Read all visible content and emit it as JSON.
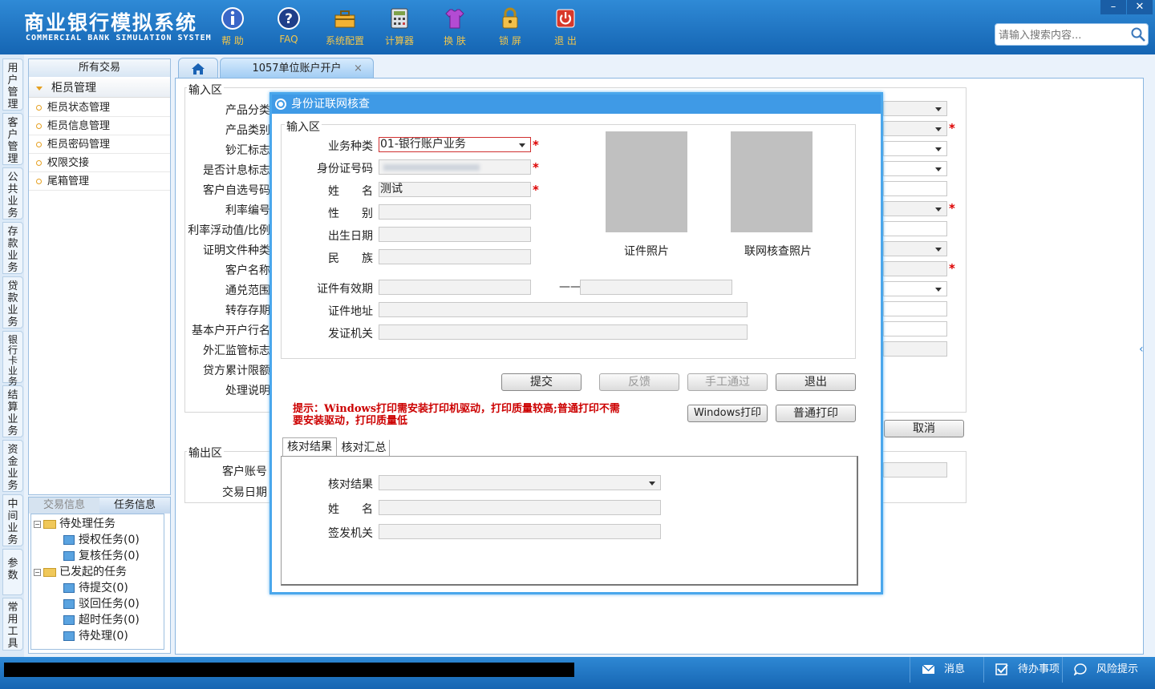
{
  "header": {
    "brand_cn": "商业银行模拟系统",
    "brand_en": "COMMERCIAL BANK SIMULATION SYSTEM",
    "tools": [
      {
        "label": "帮 助",
        "icon": "info-icon"
      },
      {
        "label": "FAQ",
        "icon": "help-icon"
      },
      {
        "label": "系统配置",
        "icon": "toolbox-icon"
      },
      {
        "label": "计算器",
        "icon": "calculator-icon"
      },
      {
        "label": "换 肤",
        "icon": "shirt-icon"
      },
      {
        "label": "锁 屏",
        "icon": "lock-icon"
      },
      {
        "label": "退 出",
        "icon": "power-icon"
      }
    ],
    "window_controls": [
      "–",
      "✕"
    ],
    "search_placeholder": "请输入搜索内容..."
  },
  "side_categories": [
    "用户管理",
    "客户管理",
    "公共业务",
    "存款业务",
    "贷款业务",
    "银行卡业务",
    "结算业务",
    "资金业务",
    "中间业务",
    "参数",
    "常用工具"
  ],
  "left_panel": {
    "header": "所有交易",
    "group": "柜员管理",
    "items": [
      "柜员状态管理",
      "柜员信息管理",
      "柜员密码管理",
      "权限交接",
      "尾箱管理"
    ]
  },
  "task_panel": {
    "tabs": [
      "交易信息",
      "任务信息"
    ],
    "pending_group": "待处理任务",
    "pending_items": [
      "授权任务(0)",
      "复核任务(0)"
    ],
    "initiated_group": "已发起的任务",
    "initiated_items": [
      "待提交(0)",
      "驳回任务(0)",
      "超时任务(0)",
      "待处理(0)"
    ]
  },
  "main_tabs": {
    "home_icon": "home-icon",
    "active_tab": "1057单位账户开户",
    "close": "×"
  },
  "form": {
    "input_legend": "输入区",
    "labels": [
      "产品分类",
      "产品类别",
      "钞汇标志",
      "是否计息标志",
      "客户自选号码",
      "利率编号",
      "利率浮动值/比例",
      "证明文件种类",
      "客户名称",
      "通兑范围",
      "转存存期",
      "基本户开户行名",
      "外汇监管标志",
      "贷方累计限额",
      "处理说明"
    ],
    "cancel_button": "取消",
    "output_legend": "输出区",
    "output_labels": [
      "客户账号",
      "交易日期"
    ]
  },
  "dialog": {
    "title": "身份证联网核查",
    "input_legend": "输入区",
    "labels": {
      "biz_type": "业务种类",
      "id_number": "身份证号码",
      "name": "姓　　名",
      "gender": "性　　别",
      "birth": "出生日期",
      "ethnicity": "民　　族",
      "validity": "证件有效期",
      "address": "证件地址",
      "issuer": "发证机关"
    },
    "values": {
      "biz_type": "01-银行账户业务",
      "name": "测试"
    },
    "validity_separator": "——",
    "photo_label": "证件照片",
    "online_photo_label": "联网核查照片",
    "buttons": {
      "submit": "提交",
      "feedback": "反馈",
      "manual": "手工通过",
      "exit": "退出",
      "windows_print": "Windows打印",
      "normal_print": "普通打印"
    },
    "tip_line1": "提示：Windows打印需安装打印机驱动，打印质量较高;普通打印不需",
    "tip_line2": "要安装驱动，打印质量低",
    "result_tabs": [
      "核对结果",
      "核对汇总"
    ],
    "result_labels": {
      "result": "核对结果",
      "name": "姓　　名",
      "issuer": "签发机关"
    }
  },
  "status_bar": {
    "items": [
      {
        "label": "消息",
        "icon": "mail-icon"
      },
      {
        "label": "待办事项",
        "icon": "checkbox-icon"
      },
      {
        "label": "风险提示",
        "icon": "chat-icon"
      }
    ]
  },
  "colors": {
    "header_blue": "#1d72c2",
    "tool_label": "#f2c64b",
    "dialog_border": "#4aa7ec",
    "required": "#dd0000",
    "tip_text": "#cc0000"
  }
}
